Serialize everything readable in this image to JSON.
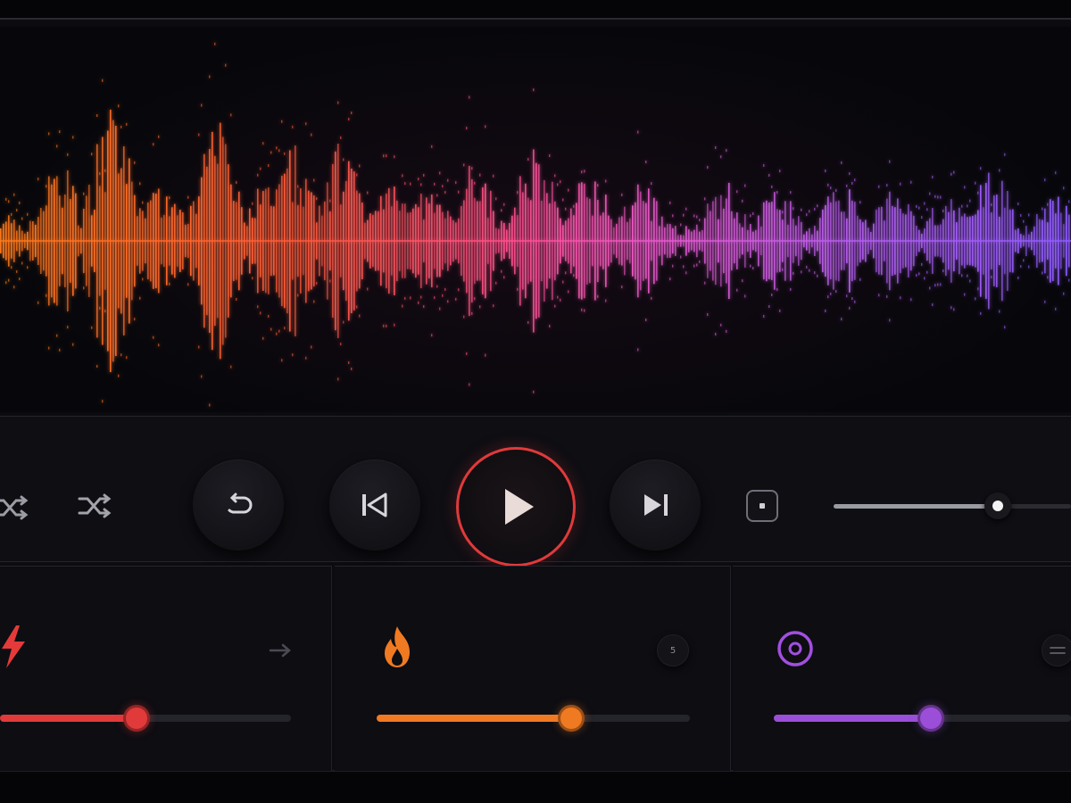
{
  "colors": {
    "accent_red": "#e03a3a",
    "accent_orange": "#f07a22",
    "accent_purple": "#9b4fd8",
    "wave_start": "#ff7a1a",
    "wave_mid": "#ff4fa0",
    "wave_end": "#9a5cff"
  },
  "transport": {
    "buttons": [
      {
        "name": "shuffle-icon-partial"
      },
      {
        "name": "shuffle-icon"
      },
      {
        "name": "repeat-icon"
      },
      {
        "name": "skip-previous-icon"
      },
      {
        "name": "play-icon"
      },
      {
        "name": "skip-next-icon"
      },
      {
        "name": "stop-square-icon"
      }
    ],
    "seek_progress": 0.69
  },
  "cards": [
    {
      "icon": "lightning-icon",
      "action_icon": "arrow-right-icon",
      "action_label": "",
      "level": 0.47,
      "color": "#e03a3a"
    },
    {
      "icon": "flame-icon",
      "action_icon": "badge-icon",
      "action_label": "5",
      "level": 0.62,
      "color": "#f07a22"
    },
    {
      "icon": "target-icon",
      "action_icon": "compare-icon",
      "action_label": "",
      "level": 0.53,
      "color": "#9b4fd8"
    }
  ]
}
